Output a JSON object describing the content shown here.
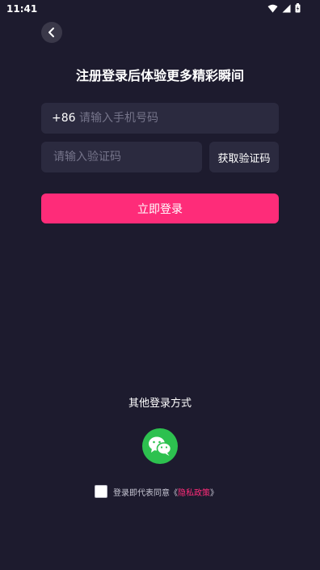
{
  "status_bar": {
    "time": "11:41"
  },
  "header": {
    "title": "注册登录后体验更多精彩瞬间"
  },
  "phone": {
    "country_code": "+86",
    "placeholder": "请输入手机号码",
    "value": ""
  },
  "code": {
    "placeholder": "请输入验证码",
    "value": "",
    "get_code_label": "获取验证码"
  },
  "login_button_label": "立即登录",
  "other_login": {
    "label": "其他登录方式",
    "options": [
      "wechat-icon"
    ]
  },
  "agreement": {
    "text": "登录即代表同意",
    "open_quote": "《",
    "link": "隐私政策",
    "close_quote": "》",
    "checked": false
  },
  "colors": {
    "background": "#1d1b2e",
    "field": "#2b2a3f",
    "accent": "#fe2c79",
    "wechat": "#2dc14f"
  }
}
